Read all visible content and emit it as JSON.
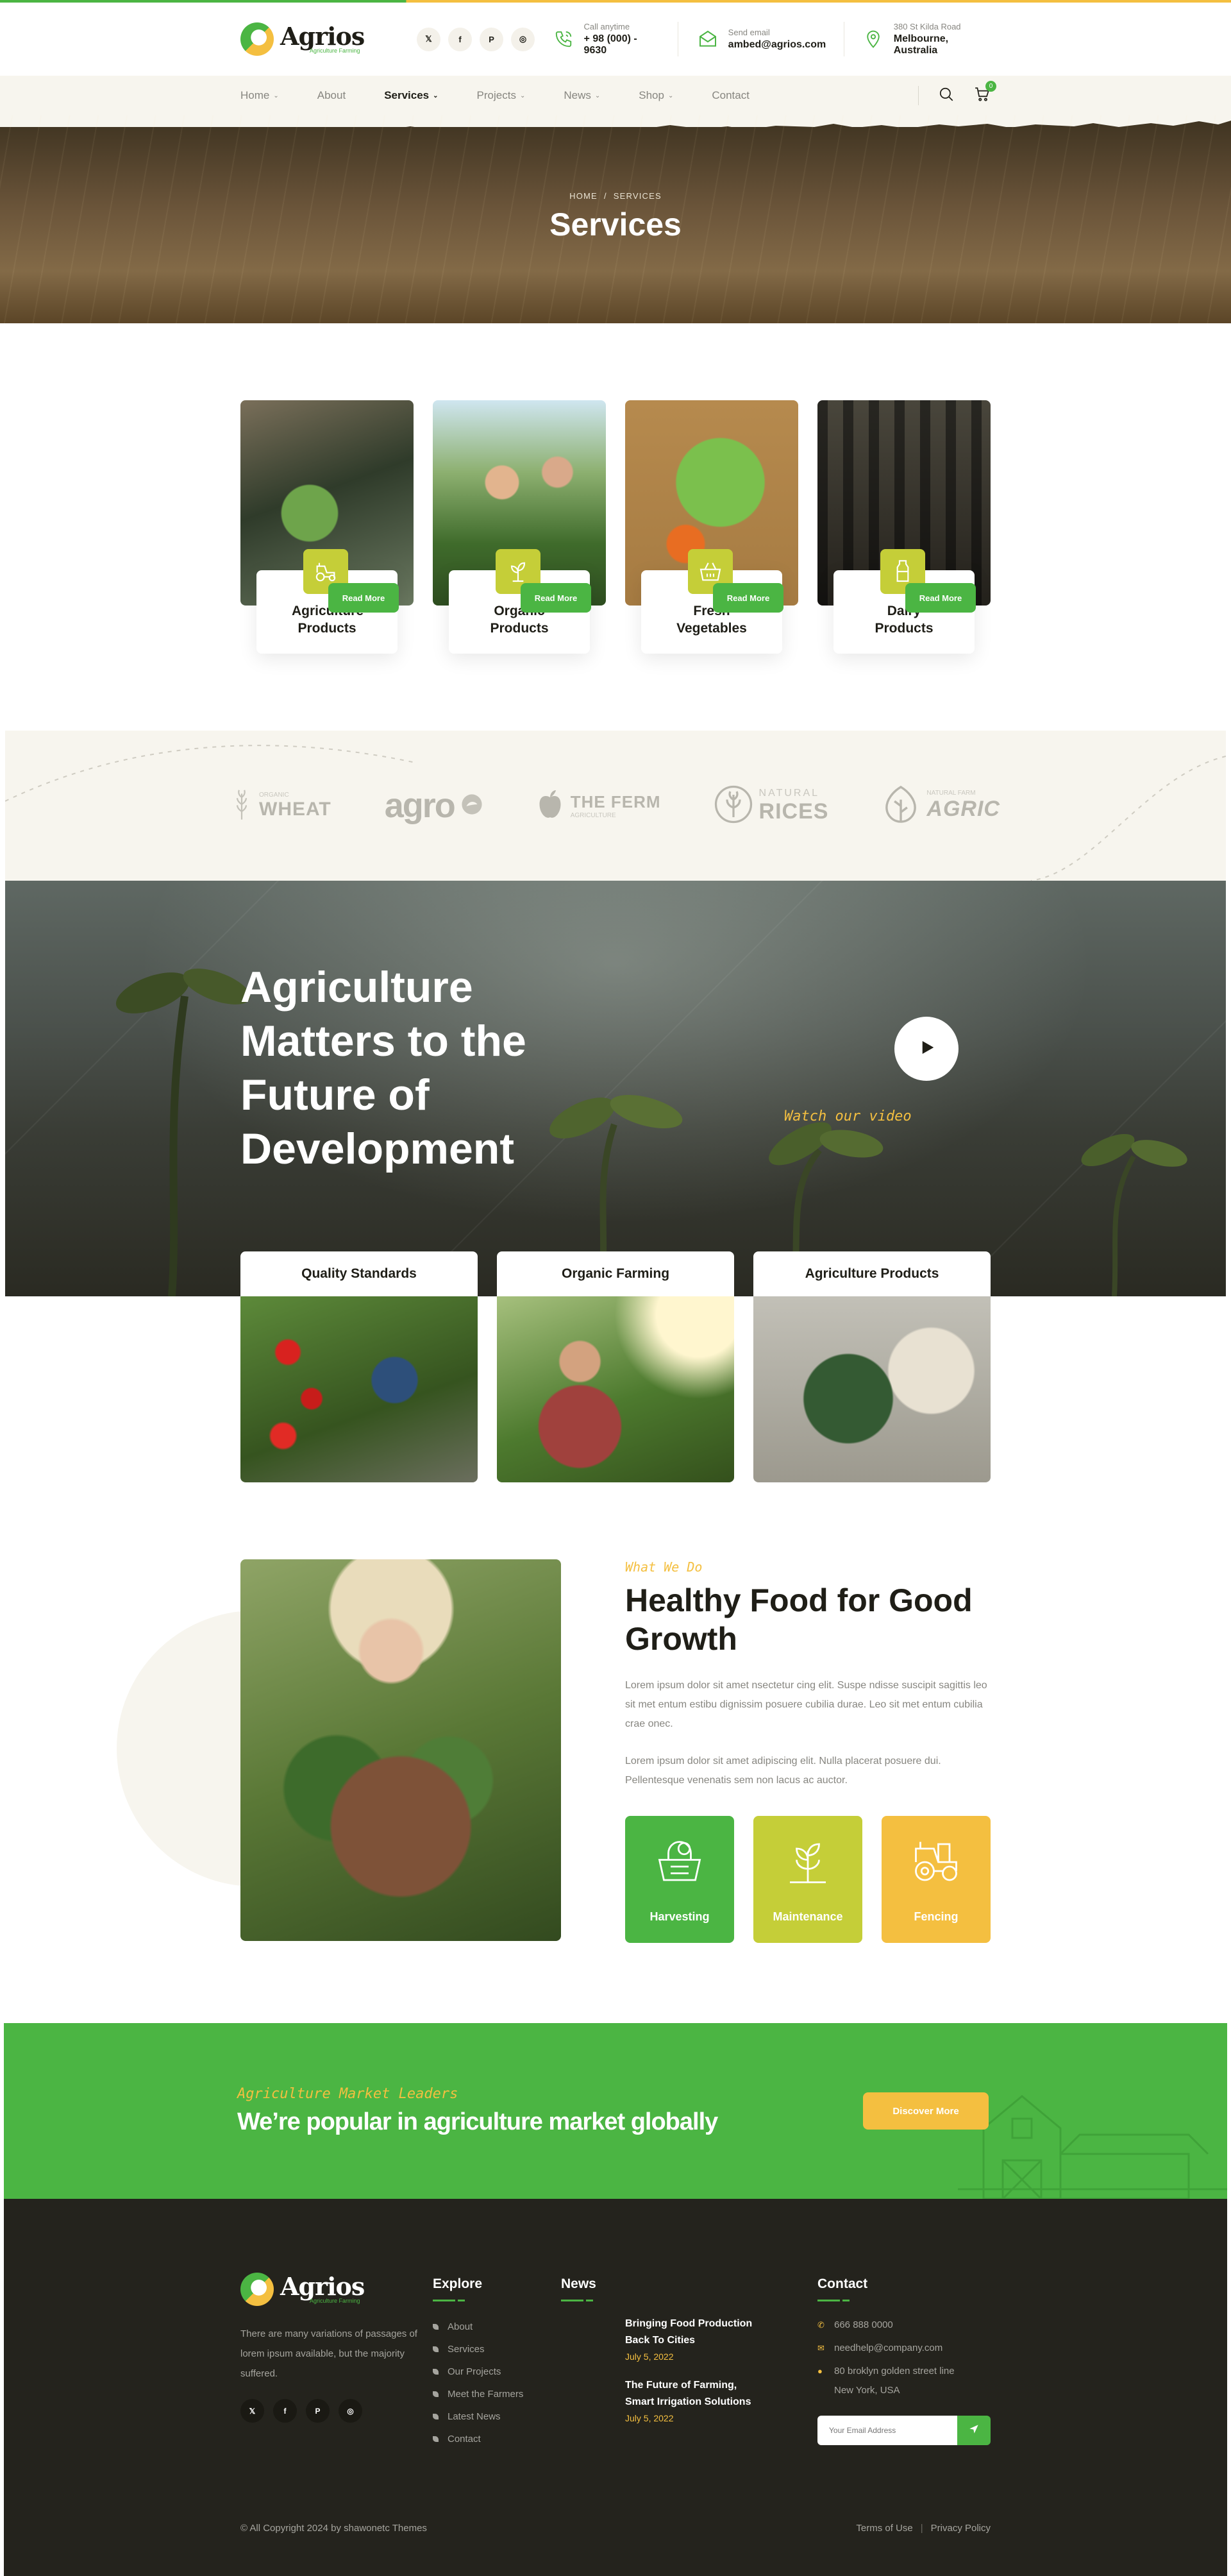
{
  "brand": {
    "name": "Agrios",
    "tagline": "Agriculture Farming"
  },
  "header": {
    "socials": [
      "twitter-icon",
      "facebook-icon",
      "pinterest-icon",
      "instagram-icon"
    ],
    "social_glyphs": [
      "𝕏",
      "f",
      "P",
      "◎"
    ],
    "contacts": [
      {
        "label": "Call anytime",
        "value": "+ 98 (000) - 9630",
        "icon": "phone-icon"
      },
      {
        "label": "Send email",
        "value": "ambed@agrios.com",
        "icon": "mail-icon"
      },
      {
        "label": "380 St Kilda Road",
        "value": "Melbourne, Australia",
        "icon": "location-icon"
      }
    ]
  },
  "nav": {
    "items": [
      {
        "label": "Home",
        "dropdown": true
      },
      {
        "label": "About",
        "dropdown": false
      },
      {
        "label": "Services",
        "dropdown": true,
        "active": true
      },
      {
        "label": "Projects",
        "dropdown": true
      },
      {
        "label": "News",
        "dropdown": true
      },
      {
        "label": "Shop",
        "dropdown": true
      },
      {
        "label": "Contact",
        "dropdown": false
      }
    ],
    "cart_count": "0"
  },
  "banner": {
    "crumb_home": "HOME",
    "crumb_sep": "/",
    "crumb_current": "SERVICES",
    "title": "Services"
  },
  "services": [
    {
      "title": "Agriculture Products",
      "button": "Read More",
      "icon": "tractor-icon"
    },
    {
      "title": "Organic Products",
      "button": "Read More",
      "icon": "plant-icon"
    },
    {
      "title": "Fresh Vegetables",
      "button": "Read More",
      "icon": "basket-icon"
    },
    {
      "title": "Dairy Products",
      "button": "Read More",
      "icon": "milk-icon"
    }
  ],
  "brands": [
    {
      "word": "WHEAT",
      "small": "ORGANIC",
      "icon": "wheat-icon"
    },
    {
      "word": "agro",
      "small": "",
      "icon": "agro-icon"
    },
    {
      "word": "THE FERM",
      "small": "AGRICULTURE",
      "icon": "apple-icon"
    },
    {
      "word": "RICES",
      "small": "NATURAL",
      "icon": "rice-icon"
    },
    {
      "word": "AGRIC",
      "small": "NATURAL FARM",
      "icon": "agric-icon"
    }
  ],
  "video": {
    "title": "Agriculture Matters to the Future of Development",
    "watch_label": "Watch our video"
  },
  "features": [
    {
      "title": "Quality Standards"
    },
    {
      "title": "Organic Farming"
    },
    {
      "title": "Agriculture Products"
    }
  ],
  "about": {
    "tagline": "What We Do",
    "title": "Healthy Food for Good Growth",
    "p1": "Lorem ipsum dolor sit amet nsectetur cing elit. Suspe ndisse suscipit sagittis leo sit met entum estibu dignissim posuere cubilia durae. Leo sit met entum cubilia crae onec.",
    "p2": "Lorem ipsum dolor sit amet adipiscing elit. Nulla placerat posuere dui. Pellentesque venenatis sem non lacus ac auctor.",
    "tiles": [
      {
        "label": "Harvesting",
        "color": "#4bb543",
        "icon": "harvest-basket-icon"
      },
      {
        "label": "Maintenance",
        "color": "#c5ce38",
        "icon": "sprout-icon"
      },
      {
        "label": "Fencing",
        "color": "#f4bf40",
        "icon": "tractor-icon"
      }
    ]
  },
  "cta": {
    "tag": "Agriculture Market Leaders",
    "title": "We’re popular in agriculture market globally",
    "button": "Discover More"
  },
  "footer": {
    "about": "There are many variations of passages of lorem ipsum available, but the majority suffered.",
    "socials": [
      "twitter-icon",
      "facebook-icon",
      "pinterest-icon",
      "instagram-icon"
    ],
    "social_glyphs": [
      "𝕏",
      "f",
      "P",
      "◎"
    ],
    "explore_title": "Explore",
    "explore": [
      "About",
      "Services",
      "Our Projects",
      "Meet the Farmers",
      "Latest News",
      "Contact"
    ],
    "news_title": "News",
    "news": [
      {
        "title": "Bringing Food Production Back To Cities",
        "date": "July 5, 2022"
      },
      {
        "title": "The Future of Farming, Smart Irrigation Solutions",
        "date": "July 5, 2022"
      }
    ],
    "contact_title": "Contact",
    "phone": "666 888 0000",
    "email": "needhelp@company.com",
    "address": "80 broklyn golden street line New York, USA",
    "email_placeholder": "Your Email Address",
    "copyright": "© All Copyright 2024 by shawonetc Themes",
    "terms": "Terms of Use",
    "legal_sep": "|",
    "privacy": "Privacy Policy"
  },
  "colors": {
    "green": "#4bb543",
    "lime": "#c5ce38",
    "yellow": "#f4bf40",
    "dark": "#1f1e17",
    "cream": "#f7f5ee"
  }
}
